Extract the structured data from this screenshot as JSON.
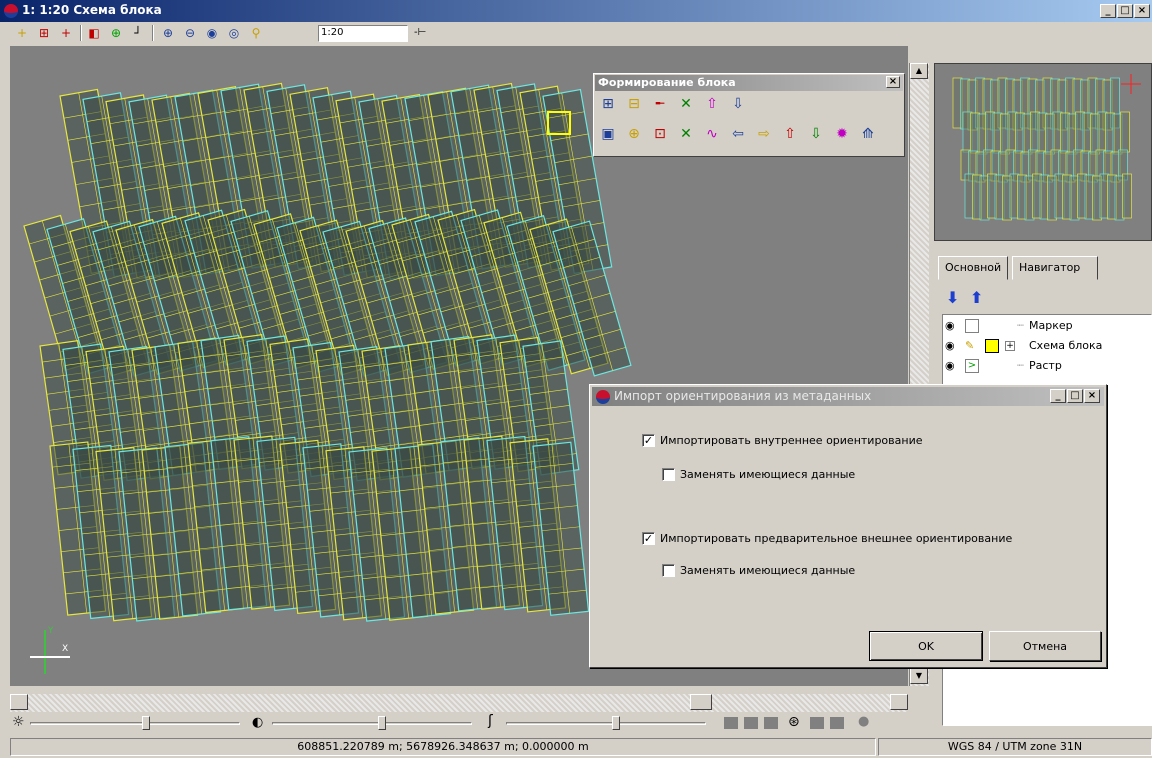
{
  "window": {
    "title": "1: 1:20 Схема блока",
    "min": "_",
    "max": "□",
    "close": "×"
  },
  "toolbar": {
    "scale_value": "1:20",
    "icons": [
      "add-point-icon",
      "add-frame-icon",
      "add-marker-icon",
      "layer-icon",
      "grid-icon",
      "corner-icon",
      "zoom-in-icon",
      "zoom-out-icon",
      "zoom-fit-icon",
      "zoom-window-icon",
      "zoom-scale-icon"
    ],
    "scale_arrow": "-⊢"
  },
  "block_tool": {
    "title": "Формирование блока",
    "close": "×"
  },
  "tree_tabs": [
    "Основной",
    "Навигатор"
  ],
  "tree": [
    {
      "label": "Маркер",
      "expander": ""
    },
    {
      "label": "Схема блока",
      "expander": "+"
    },
    {
      "label": "Растр",
      "expander": ""
    }
  ],
  "dialog": {
    "title": "Импорт ориентирования из метаданных",
    "options": [
      {
        "label": "Импортировать внутреннее ориентирование",
        "checked": "✓"
      },
      {
        "label": "Заменять имеющиеся данные",
        "checked": ""
      },
      {
        "label": "Импортировать предварительное внешнее ориентирование",
        "checked": "✓"
      },
      {
        "label": "Заменять имеющиеся данные",
        "checked": ""
      }
    ],
    "ok": "OK",
    "cancel": "Отмена"
  },
  "axis": {
    "x": "X",
    "y": "Y"
  },
  "status": {
    "coords": "608851.220789 m; 5678926.348637 m; 0.000000 m",
    "crs": "WGS 84 / UTM zone 31N"
  },
  "sliders": {
    "brightness": 0.55,
    "contrast": 0.55,
    "gamma": 0.55
  },
  "colors": {
    "frame_cyan": "#6ee6e0",
    "frame_yellow": "#e6e640",
    "map_bg": "#808080",
    "title_blue": "#0a246a"
  }
}
